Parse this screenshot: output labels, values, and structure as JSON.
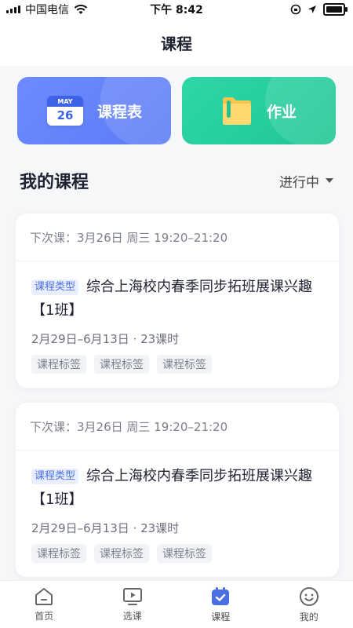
{
  "status_bar": {
    "carrier": "中国电信",
    "time": "下午 8:42"
  },
  "header": {
    "title": "课程"
  },
  "features": {
    "schedule": {
      "label": "课程表",
      "calendar_month": "MAY",
      "calendar_day": "26"
    },
    "homework": {
      "label": "作业"
    }
  },
  "section": {
    "title": "我的课程",
    "filter_label": "进行中"
  },
  "courses": [
    {
      "next_class": "下次课：3月26日 周三 19:20–21:20",
      "type": "课程类型",
      "title": "综合上海校内春季同步拓班展课兴趣【1班】",
      "date_range": "2月29日–6月13日",
      "lessons": "23课时",
      "tags": [
        "课程标签",
        "课程标签",
        "课程标签"
      ]
    },
    {
      "next_class": "下次课：3月26日 周三 19:20–21:20",
      "type": "课程类型",
      "title": "综合上海校内春季同步拓班展课兴趣【1班】",
      "date_range": "2月29日–6月13日",
      "lessons": "23课时",
      "tags": [
        "课程标签",
        "课程标签",
        "课程标签"
      ]
    }
  ],
  "tabbar": {
    "items": [
      {
        "label": "首页",
        "icon": "home-icon"
      },
      {
        "label": "选课",
        "icon": "play-screen-icon"
      },
      {
        "label": "课程",
        "icon": "calendar-check-icon",
        "active": true
      },
      {
        "label": "我的",
        "icon": "smiley-icon"
      }
    ]
  },
  "colors": {
    "accent": "#4a6fe3",
    "schedule_card": "#6d8bff",
    "homework_card": "#1fc594"
  }
}
